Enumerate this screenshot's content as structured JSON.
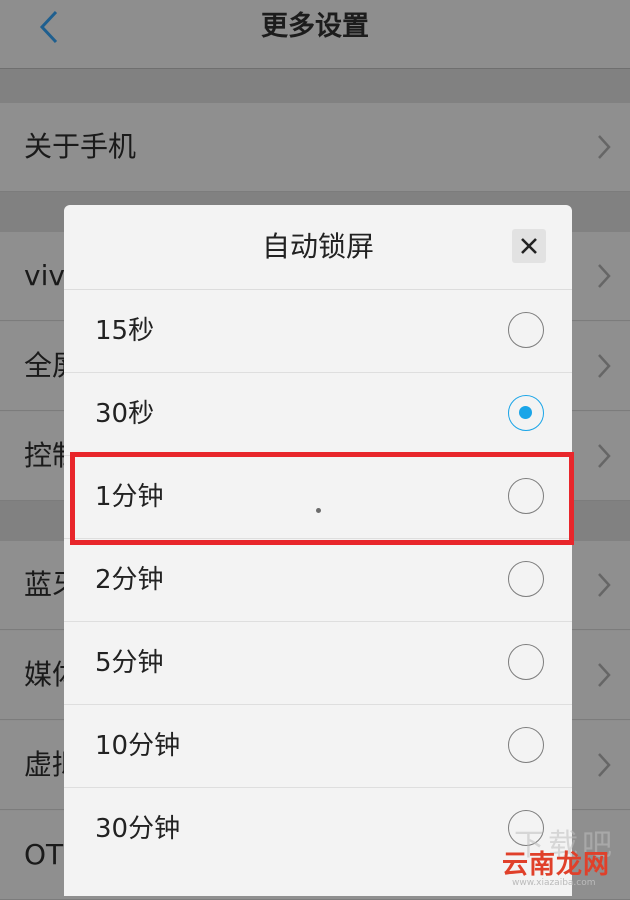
{
  "header": {
    "title": "更多设置"
  },
  "background_rows": [
    {
      "label": "关于手机"
    },
    {
      "label": "viv"
    },
    {
      "label": "全屏"
    },
    {
      "label": "控制"
    },
    {
      "label": "蓝牙"
    },
    {
      "label": "媒体"
    },
    {
      "label": "虚拟"
    },
    {
      "label": "OTG"
    }
  ],
  "dialog": {
    "title": "自动锁屏",
    "options": [
      {
        "label": "15秒",
        "checked": false
      },
      {
        "label": "30秒",
        "checked": true
      },
      {
        "label": "1分钟",
        "checked": false
      },
      {
        "label": "2分钟",
        "checked": false
      },
      {
        "label": "5分钟",
        "checked": false
      },
      {
        "label": "10分钟",
        "checked": false
      },
      {
        "label": "30分钟",
        "checked": false
      }
    ],
    "highlighted_option": "1分钟"
  },
  "colors": {
    "accent": "#1aa5e8",
    "highlight": "#e8262b"
  },
  "watermark": {
    "text": "云南龙网",
    "url": "www.xiazaiba.com",
    "seal": "下载吧"
  }
}
